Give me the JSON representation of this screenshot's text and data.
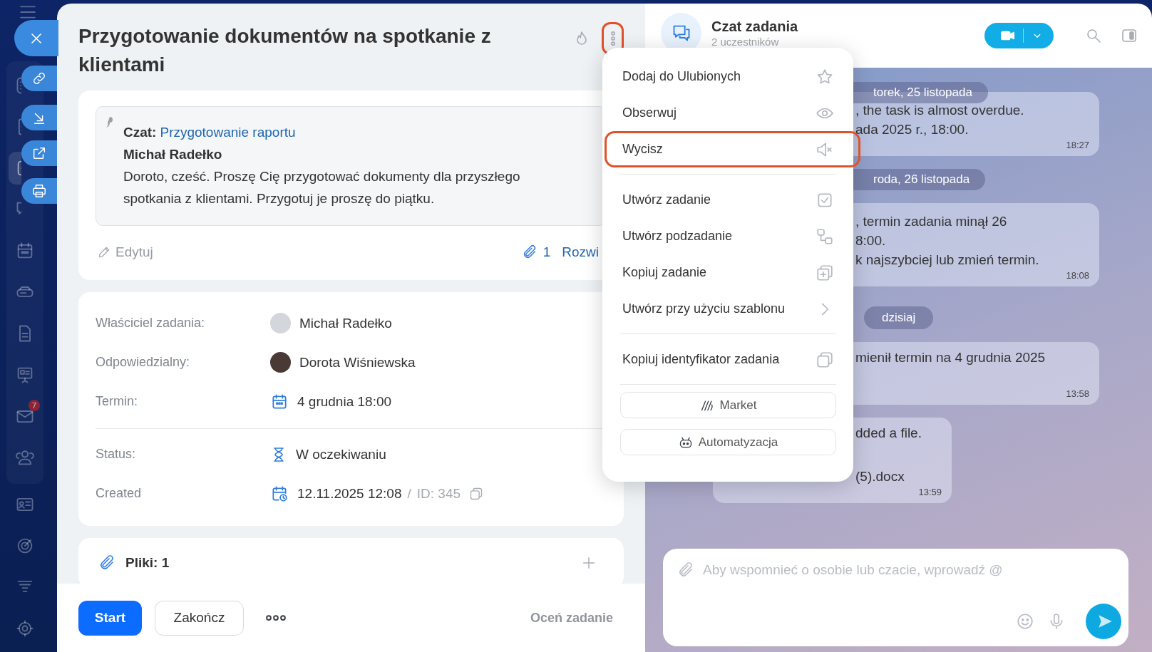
{
  "sidebar": {
    "items": [
      {
        "selected": false
      },
      {
        "selected": false
      },
      {
        "selected": true
      },
      {
        "selected": false
      },
      {
        "selected": false
      },
      {
        "selected": false
      },
      {
        "selected": false
      },
      {
        "selected": false
      },
      {
        "selected": false,
        "badge": "7"
      },
      {
        "selected": false
      },
      {
        "selected": false
      },
      {
        "selected": false
      },
      {
        "selected": false
      },
      {
        "selected": false
      }
    ]
  },
  "task": {
    "title": "Przygotowanie dokumentów na spotkanie z klientami",
    "more_highlighted": true,
    "description": {
      "chat_label": "Czat:",
      "chat_link": "Przygotowanie raportu",
      "author": "Michał Radełko",
      "text": "Doroto, cześć. Proszę Cię przygotować dokumenty dla przyszłego spotkania z klientami. Przygotuj je proszę do piątku."
    },
    "edit": "Edytuj",
    "attachments": "1",
    "expand": "Rozwi",
    "field_groups": [
      [
        {
          "kind": "person",
          "label": "Właściciel zadania:",
          "value": "Michał Radełko"
        },
        {
          "kind": "person",
          "label": "Odpowiedzialny:",
          "value": "Dorota Wiśniewska"
        },
        {
          "kind": "deadline",
          "label": "Termin:",
          "value": "4 grudnia 18:00"
        }
      ],
      [
        {
          "kind": "status",
          "label": "Status:",
          "value": "W oczekiwaniu"
        },
        {
          "kind": "created",
          "label": "Created",
          "value": "12.11.2025 12:08",
          "separator": "/",
          "id": "ID: 345"
        }
      ]
    ],
    "files": "Pliki: 1",
    "footer": {
      "start": "Start",
      "finish": "Zakończ",
      "rate": "Oceń zadanie"
    }
  },
  "menu": {
    "groups": [
      [
        {
          "label": "Dodaj do Ulubionych",
          "highlighted": false
        },
        {
          "label": "Obserwuj",
          "highlighted": false
        },
        {
          "label": "Wycisz",
          "highlighted": true
        }
      ],
      [
        {
          "label": "Utwórz zadanie",
          "highlighted": false
        },
        {
          "label": "Utwórz podzadanie",
          "highlighted": false
        },
        {
          "label": "Kopiuj zadanie",
          "highlighted": false
        },
        {
          "label": "Utwórz przy użyciu szablonu",
          "highlighted": false
        }
      ],
      [
        {
          "label": "Kopiuj identyfikator zadania",
          "highlighted": false
        }
      ]
    ],
    "buttons": [
      "Market",
      "Automatyzacja"
    ]
  },
  "chat": {
    "title": "Czat zadania",
    "subtitle": "2 uczestników",
    "timeline": [
      {
        "kind": "date",
        "text": "torek, 25 listopada"
      },
      {
        "kind": "message",
        "lines": [
          ", the task is almost overdue.",
          "ada 2025 r., 18:00."
        ],
        "time": "18:27"
      },
      {
        "kind": "date",
        "text": "roda, 26 listopada"
      },
      {
        "kind": "message",
        "lines": [
          ", termin zadania minął 26",
          "8:00.",
          "k najszybciej lub zmień termin."
        ],
        "time": "18:08"
      },
      {
        "kind": "today",
        "text": "dzisiaj"
      },
      {
        "kind": "message",
        "lines": [
          "mienił termin na 4 grudnia 2025"
        ],
        "time": "13:58"
      },
      {
        "kind": "file",
        "lines": [
          "dded a file."
        ],
        "file": "(5).docx",
        "time": "13:59"
      }
    ],
    "input": {
      "placeholder": "Aby wspomnieć o osobie lub czacie, wprowadź @"
    }
  }
}
